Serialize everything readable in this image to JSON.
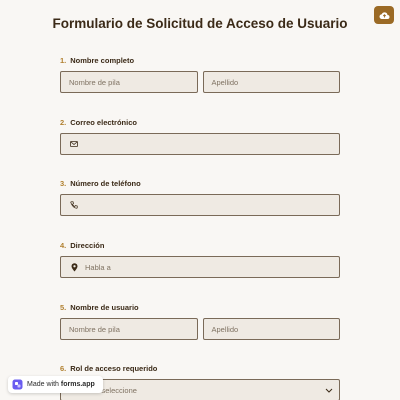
{
  "header": {
    "title": "Formulario de Solicitud de Acceso de Usuario",
    "top_button_icon": "cloud-upload-icon"
  },
  "questions": [
    {
      "number": "1.",
      "label": "Nombre completo",
      "fields": [
        {
          "placeholder": "Nombre de pila"
        },
        {
          "placeholder": "Apellido"
        }
      ]
    },
    {
      "number": "2.",
      "label": "Correo electrónico",
      "icon": "envelope-icon",
      "placeholder": ""
    },
    {
      "number": "3.",
      "label": "Número de teléfono",
      "icon": "phone-icon",
      "placeholder": ""
    },
    {
      "number": "4.",
      "label": "Dirección",
      "icon": "location-pin-icon",
      "placeholder": "Habla a"
    },
    {
      "number": "5.",
      "label": "Nombre de usuario",
      "fields": [
        {
          "placeholder": "Nombre de pila"
        },
        {
          "placeholder": "Apellido"
        }
      ]
    },
    {
      "number": "6.",
      "label": "Rol de acceso requerido",
      "select_value": "Por favor seleccione"
    }
  ],
  "badge": {
    "made_with": "Made with",
    "brand": "forms.app"
  },
  "colors": {
    "accent": "#9b6a25",
    "number": "#b07f2e",
    "field_bg": "#efeae3",
    "field_border": "#7a6a58",
    "page_bg": "#f9f7f4"
  }
}
